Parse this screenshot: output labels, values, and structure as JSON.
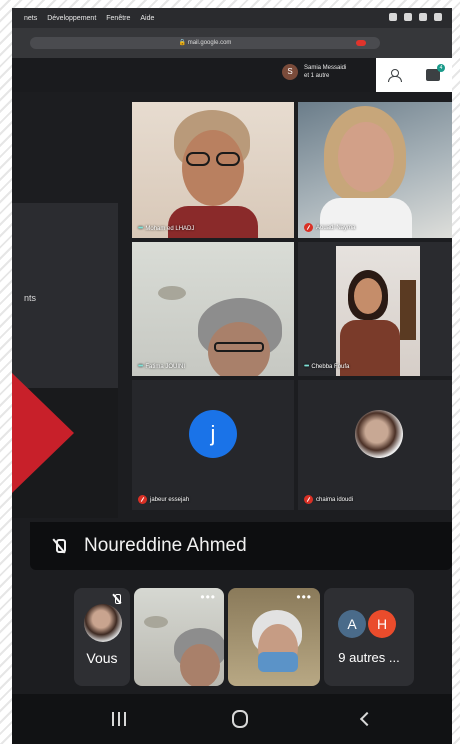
{
  "menubar": {
    "items": [
      "nets",
      "Développement",
      "Fenêtre",
      "Aide"
    ]
  },
  "browser": {
    "url": "mail.google.com"
  },
  "meet": {
    "presenter_initial": "S",
    "presenter_line1": "Samia Messaidi",
    "presenter_line2": "et 1 autre",
    "chat_badge": "4",
    "side_label": "nts",
    "tiles": [
      {
        "name": "Moham ed LHADJ",
        "muted": false
      },
      {
        "name": "Aouadi Nayma",
        "muted": true
      },
      {
        "name": "Fatima JOUINI",
        "muted": false
      },
      {
        "name": "Chebba Foufa",
        "muted": false
      },
      {
        "name": "jabeur essejah",
        "muted": true,
        "avatar_letter": "j"
      },
      {
        "name": "chaima idoudi",
        "muted": true
      }
    ],
    "presenting_name": "Noureddine Ahmed"
  },
  "bottom_strip": {
    "self_label": "Vous",
    "more_glyph": "•••",
    "others_initials": [
      "A",
      "H"
    ],
    "others_label": "9 autres ..."
  },
  "colors": {
    "accent_red": "#c8202a",
    "avatar_blue": "#1a73e8",
    "avatar_h": "#ea4c2c",
    "avatar_a": "#4a6b8a"
  }
}
